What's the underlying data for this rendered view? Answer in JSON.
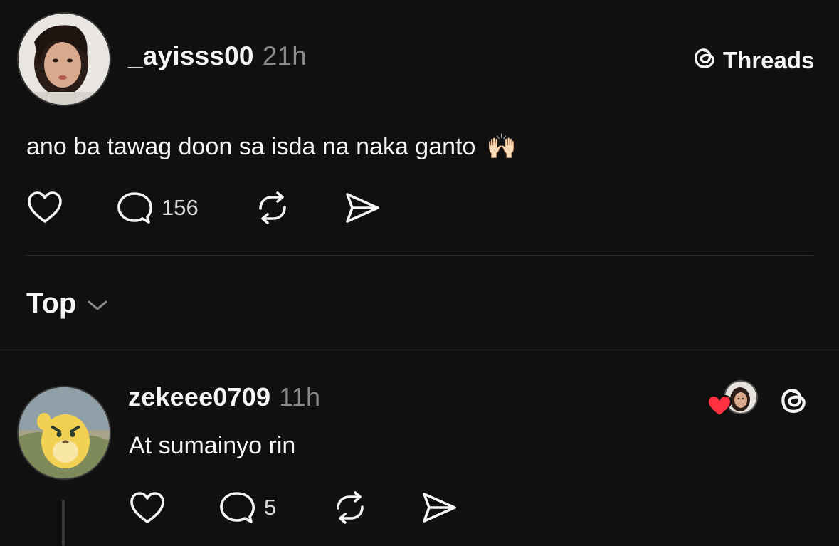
{
  "post": {
    "username": "_ayisss00",
    "time": "21h",
    "text": "ano ba tawag doon sa isda na naka ganto",
    "emoji": "🙌🏻",
    "reply_count": "156"
  },
  "brand": {
    "label": "Threads"
  },
  "sort": {
    "label": "Top"
  },
  "reply": {
    "username": "zekeee0709",
    "time": "11h",
    "text": "At sumainyo rin",
    "reply_count": "5"
  },
  "colors": {
    "background": "#101010",
    "text": "#f3f5f7",
    "muted": "#8a8a8a",
    "like_red": "#ff3040"
  },
  "icons": [
    "heart-icon",
    "comment-icon",
    "repost-icon",
    "share-icon",
    "threads-logo-icon",
    "chevron-down-icon"
  ]
}
